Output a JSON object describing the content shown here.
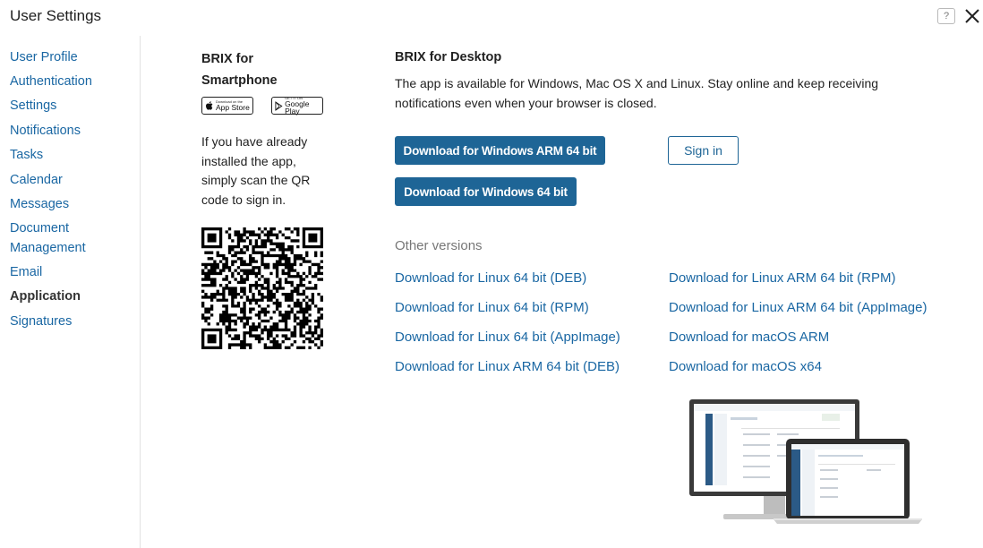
{
  "window": {
    "title": "User Settings",
    "help_label": "?"
  },
  "sidebar": {
    "items": [
      {
        "label": "User Profile",
        "active": false
      },
      {
        "label": "Authentication",
        "active": false
      },
      {
        "label": "Settings",
        "active": false
      },
      {
        "label": "Notifications",
        "active": false
      },
      {
        "label": "Tasks",
        "active": false
      },
      {
        "label": "Calendar",
        "active": false
      },
      {
        "label": "Messages",
        "active": false
      },
      {
        "label": "Document",
        "active": false
      },
      {
        "label": "Management",
        "active": false
      },
      {
        "label": "Email",
        "active": false
      },
      {
        "label": "Application",
        "active": true
      },
      {
        "label": "Signatures",
        "active": false
      }
    ]
  },
  "smartphone": {
    "title_line1": "BRIX for",
    "title_line2": "Smartphone",
    "appstore_small": "Download on the",
    "appstore_big": "App Store",
    "googleplay_small": "GET IT ON",
    "googleplay_big": "Google Play",
    "instructions_line1": "If you have already",
    "instructions_line2": "installed the app,",
    "instructions_line3": "simply scan the QR",
    "instructions_line4": "code to sign in."
  },
  "desktop": {
    "title": "BRIX for Desktop",
    "desc_line1": "The app is available for Windows, Mac OS X and Linux. Stay online and keep receiving",
    "desc_line2": "notifications even when your browser is closed.",
    "btn_windows_arm": "Download for Windows ARM 64 bit",
    "btn_windows": "Download for Windows 64 bit",
    "btn_signin": "Sign in",
    "other_versions_label": "Other versions",
    "links_left": [
      "Download for Linux 64 bit (DEB)",
      "Download for Linux 64 bit (RPM)",
      "Download for Linux 64 bit (AppImage)",
      "Download for Linux ARM 64 bit (DEB)"
    ],
    "links_right": [
      "Download for Linux ARM 64 bit (RPM)",
      "Download for Linux ARM 64 bit (AppImage)",
      "Download for macOS ARM",
      "Download for macOS x64"
    ]
  },
  "colors": {
    "link": "#1a67a3",
    "primary_button": "#1e6596",
    "muted": "#777777"
  }
}
